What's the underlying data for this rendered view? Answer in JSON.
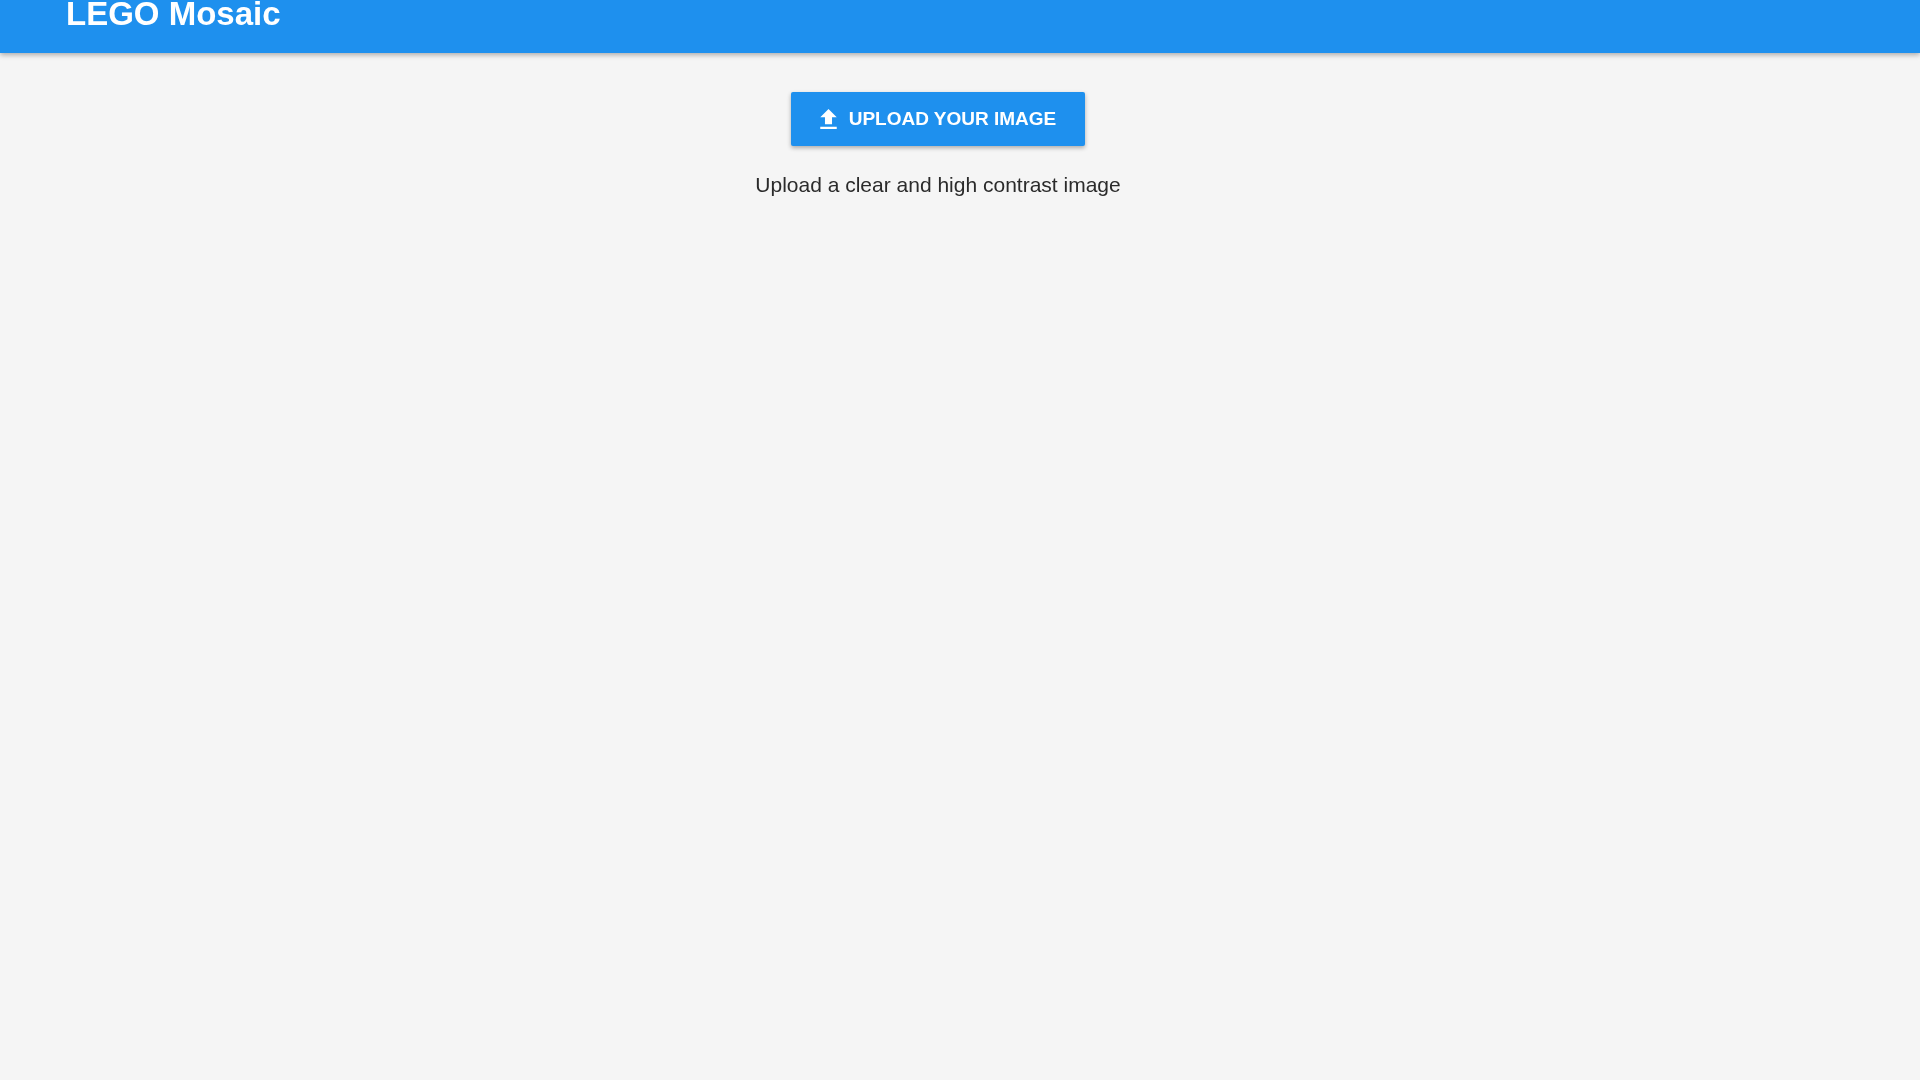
{
  "app_bar": {
    "title": "LEGO Mosaic"
  },
  "upload_button": {
    "label": "UPLOAD YOUR IMAGE"
  },
  "hint": "Upload a clear and high contrast image"
}
